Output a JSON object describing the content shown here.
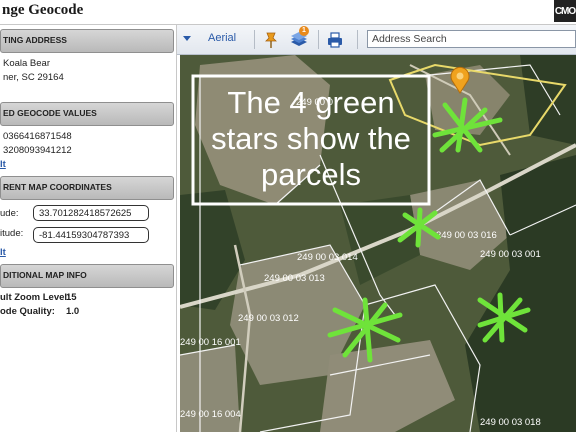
{
  "window": {
    "title": "nge Geocode",
    "logo": "CMO"
  },
  "left_panel": {
    "existing_address": {
      "header": "TING ADDRESS",
      "line1": "Koala Bear",
      "line2": "ner, SC 29164"
    },
    "geocode_values": {
      "header": "ED GEOCODE VALUES",
      "value1": "0366416871548",
      "value2": "3208093941212",
      "link": "lt"
    },
    "current_coordinates": {
      "header": "RENT MAP COORDINATES",
      "lat_label": "ude:",
      "lat_value": "33.701282418572625",
      "lon_label": "itude:",
      "lon_value": "-81.44159304787393",
      "link": "lt"
    },
    "additional_info": {
      "header": "DITIONAL MAP INFO",
      "zoom_label": "ult Zoom Level:",
      "zoom_value": "15",
      "quality_label": "ode Quality:",
      "quality_value": "1.0"
    }
  },
  "toolbar": {
    "view_label": "Aerial",
    "badge_count": "1",
    "search_placeholder": "Address Search"
  },
  "map": {
    "annotation_line1": "The 4 green",
    "annotation_line2": "stars show the",
    "annotation_line3": "parcels",
    "parcel_labels": [
      "249 00 0",
      "249 00 03 016",
      "249 00 03 001",
      "249 00 03 014",
      "249 00 03 013",
      "249 00 03 012",
      "249 00 16 001",
      "249 00 16 004",
      "249 00 03 018"
    ],
    "star_color": "#6fe33a",
    "marker_color": "#f0a21e"
  }
}
